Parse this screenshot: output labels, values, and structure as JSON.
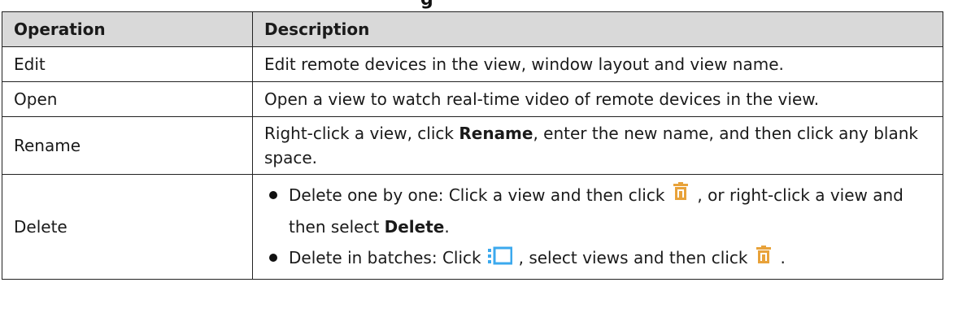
{
  "table": {
    "headers": [
      "Operation",
      "Description"
    ],
    "rows": [
      {
        "operation": "Edit",
        "description": "Edit remote devices in the view, window layout and view name."
      },
      {
        "operation": "Open",
        "description": "Open a view to watch real-time video of remote devices in the view."
      },
      {
        "operation": "Rename",
        "desc_before": "Right-click a view, click ",
        "desc_bold": "Rename",
        "desc_after": ", enter the new name, and then click any blank space."
      },
      {
        "operation": "Delete",
        "bullet1": {
          "text_before": "Delete one by one: Click a view and then click",
          "icon": "trash-icon",
          "text_after": ", or right-click a view and then select ",
          "bold": "Delete",
          "end": "."
        },
        "bullet2": {
          "text_before": "Delete in batches: Click",
          "icon": "batch-select-icon",
          "text_middle": ", select views and then click",
          "icon2": "trash-icon",
          "end": "."
        }
      }
    ]
  },
  "colors": {
    "header_bg": "#d9d9d9",
    "border": "#222222",
    "icon_blue": "#3ba9ee",
    "icon_orange": "#e8a23a"
  }
}
